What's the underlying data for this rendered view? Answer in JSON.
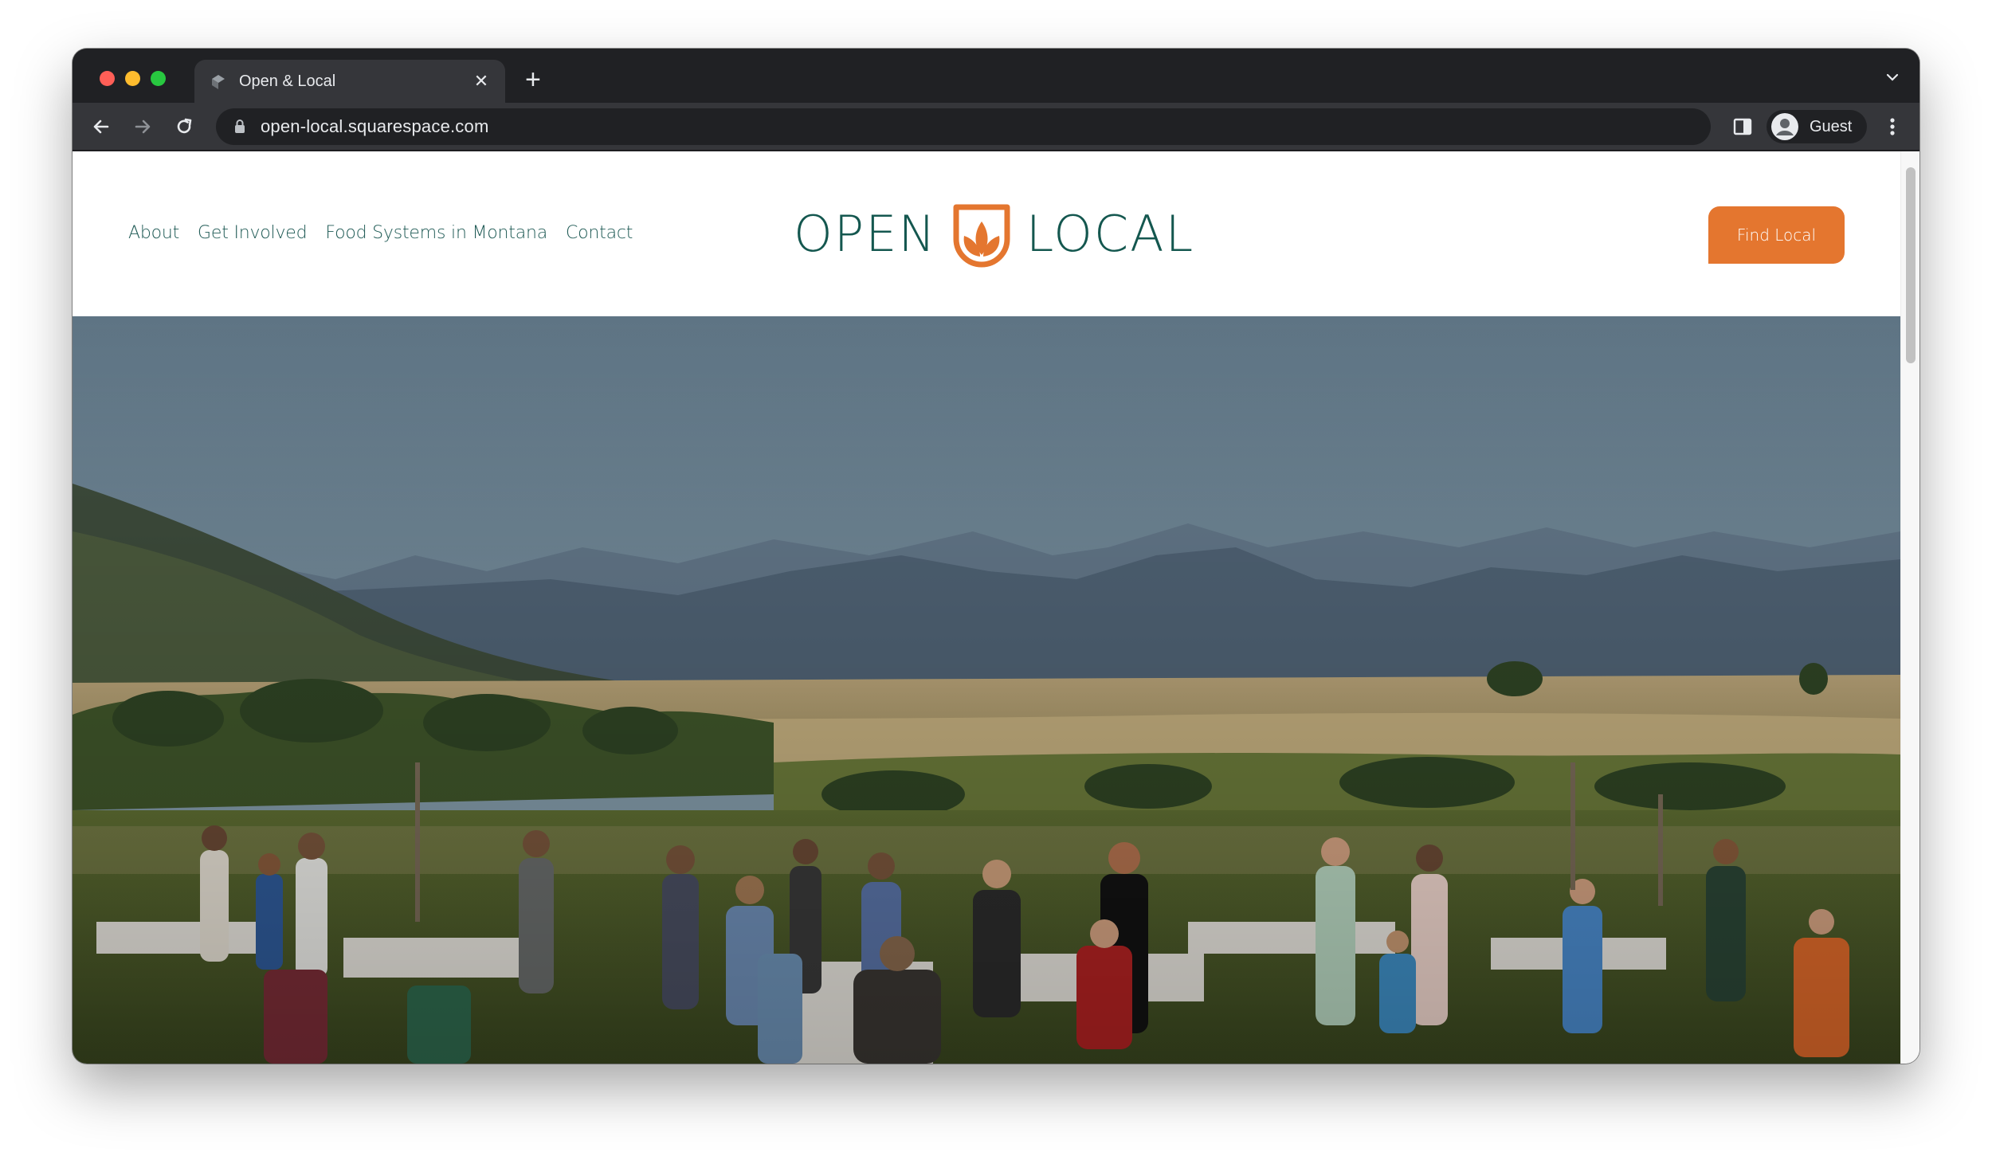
{
  "browser": {
    "tab_title": "Open & Local",
    "url": "open-local.squarespace.com",
    "profile_label": "Guest",
    "icons": {
      "favicon": "squarespace-favicon-icon",
      "close_tab": "close-icon",
      "new_tab": "plus-icon",
      "tab_search": "chevron-down-icon",
      "back": "arrow-left-icon",
      "forward": "arrow-right-icon",
      "reload": "reload-icon",
      "lock": "lock-icon",
      "side_panel": "side-panel-icon",
      "profile": "person-icon",
      "menu": "kebab-menu-icon"
    }
  },
  "site": {
    "nav": [
      {
        "label": "About"
      },
      {
        "label": "Get Involved"
      },
      {
        "label": "Food Systems in Montana"
      },
      {
        "label": "Contact"
      }
    ],
    "logo": {
      "left_word": "OPEN",
      "right_word": "LOCAL",
      "color": "#14574f",
      "mark_color": "#e4762f"
    },
    "cta_label": "Find Local",
    "cta_color": "#e4762f",
    "nav_color": "#1f5a55",
    "hero_image": "photo of a community dinner gathering outdoors in a Montana farm field with mountains in the background"
  }
}
